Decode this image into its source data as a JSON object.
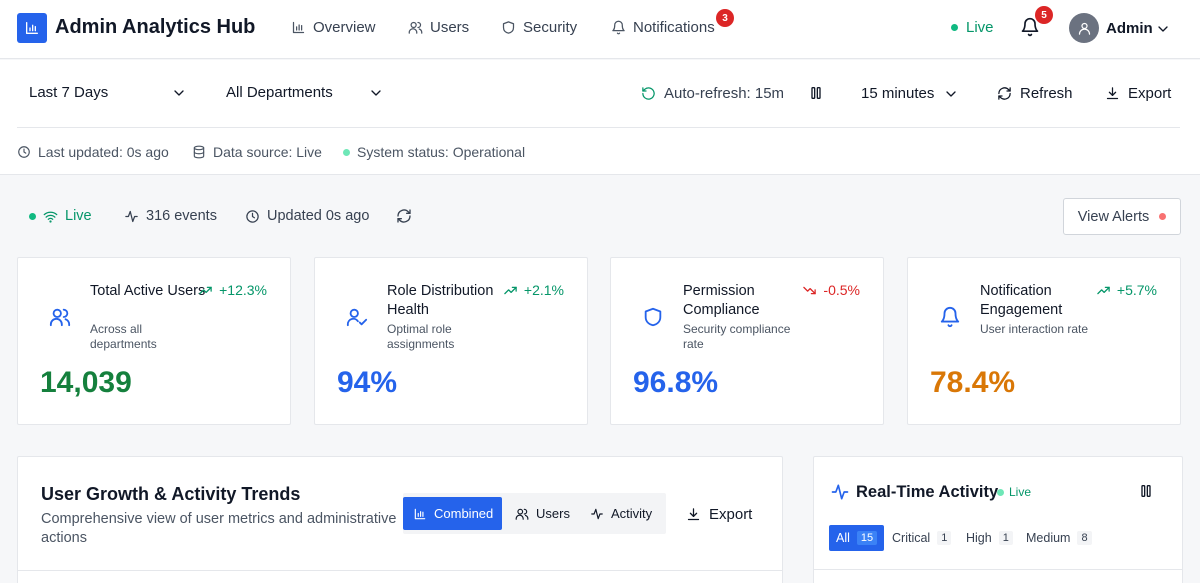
{
  "app": {
    "title": "Admin Analytics Hub"
  },
  "nav": {
    "items": [
      {
        "label": "Overview",
        "icon": "bar-chart-icon"
      },
      {
        "label": "Users",
        "icon": "users-icon"
      },
      {
        "label": "Security",
        "icon": "shield-icon"
      },
      {
        "label": "Notifications",
        "icon": "bell-icon",
        "badge": "3"
      }
    ],
    "live_label": "Live",
    "bell_badge": "5",
    "user_label": "Admin"
  },
  "filters": {
    "date_range": "Last 7 Days",
    "department": "All Departments",
    "auto_refresh": "Auto-refresh: 15m",
    "interval": "15 minutes",
    "refresh_label": "Refresh",
    "export_label": "Export"
  },
  "status": {
    "last_updated": "Last updated: 0s ago",
    "data_source": "Data source: Live",
    "system_status": "System status: Operational"
  },
  "live_strip": {
    "live": "Live",
    "events": "316 events",
    "updated": "Updated 0s ago",
    "view_alerts": "View Alerts"
  },
  "kpis": [
    {
      "title": "Total Active Users",
      "subtitle": "Across all departments",
      "delta": "+12.3%",
      "trend": "up",
      "value": "14,039",
      "value_color": "#15803d",
      "icon": "users-icon"
    },
    {
      "title": "Role Distribution Health",
      "subtitle": "Optimal role assignments",
      "delta": "+2.1%",
      "trend": "up",
      "value": "94%",
      "value_color": "#2563eb",
      "icon": "user-check-icon"
    },
    {
      "title": "Permission Compliance",
      "subtitle": "Security compliance rate",
      "delta": "-0.5%",
      "trend": "down",
      "value": "96.8%",
      "value_color": "#2563eb",
      "icon": "shield-icon"
    },
    {
      "title": "Notification Engagement",
      "subtitle": "User interaction rate",
      "delta": "+5.7%",
      "trend": "up",
      "value": "78.4%",
      "value_color": "#d97706",
      "icon": "bell-icon"
    }
  ],
  "chart_panel": {
    "title": "User Growth & Activity Trends",
    "subtitle": "Comprehensive view of user metrics and administrative actions",
    "tabs": [
      "Combined",
      "Users",
      "Activity"
    ],
    "active_tab": "Combined",
    "export_label": "Export"
  },
  "realtime": {
    "title": "Real-Time Activity",
    "live": "Live",
    "filters": [
      {
        "label": "All",
        "count": "15",
        "active": true
      },
      {
        "label": "Critical",
        "count": "1"
      },
      {
        "label": "High",
        "count": "1"
      },
      {
        "label": "Medium",
        "count": "8"
      }
    ]
  },
  "colors": {
    "accent": "#2563eb",
    "live_green": "#059669",
    "badge_red": "#dc2626",
    "up_green": "#059669",
    "down_red": "#dc2626"
  }
}
